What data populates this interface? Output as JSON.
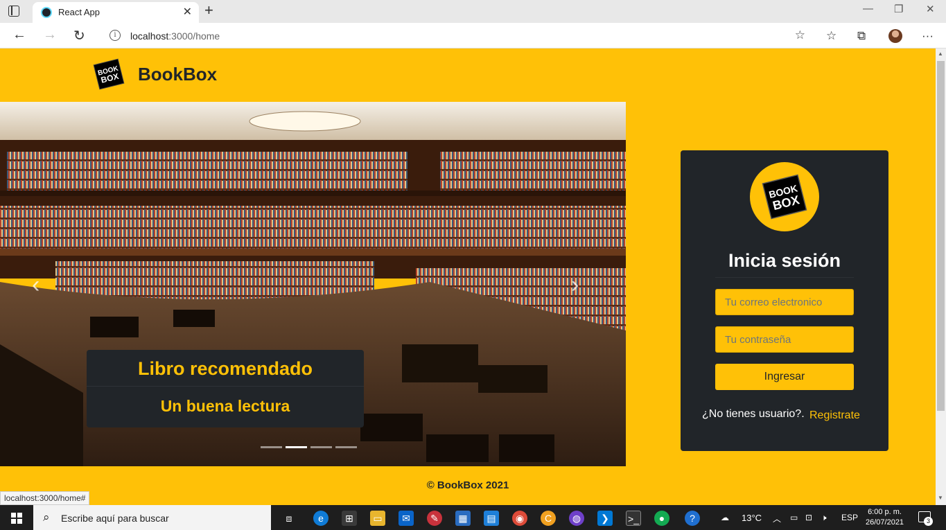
{
  "browser": {
    "tab_title": "React App",
    "url_host": "localhost",
    "url_path": ":3000/home",
    "status_url": "localhost:3000/home#"
  },
  "header": {
    "brand_name": "BookBox",
    "logo_text_1": "BOOK",
    "logo_text_2": "BOX"
  },
  "carousel": {
    "caption_title": "Libro recomendado",
    "caption_text": "Un buena lectura",
    "indicator_count": 4,
    "active_index": 1
  },
  "login": {
    "title": "Inicia sesión",
    "email_placeholder": "Tu correo electronico",
    "password_placeholder": "Tu contraseña",
    "submit_label": "Ingresar",
    "signup_question": "¿No tienes usuario?.",
    "signup_link": "Registrate"
  },
  "footer": {
    "text": "© BookBox 2021"
  },
  "taskbar": {
    "search_placeholder": "Escribe aquí para buscar",
    "weather": "13°C",
    "language": "ESP",
    "time": "6:00 p. m.",
    "date": "26/07/2021",
    "notification_count": "3"
  },
  "colors": {
    "brand_yellow": "#ffc107",
    "dark": "#212529"
  }
}
